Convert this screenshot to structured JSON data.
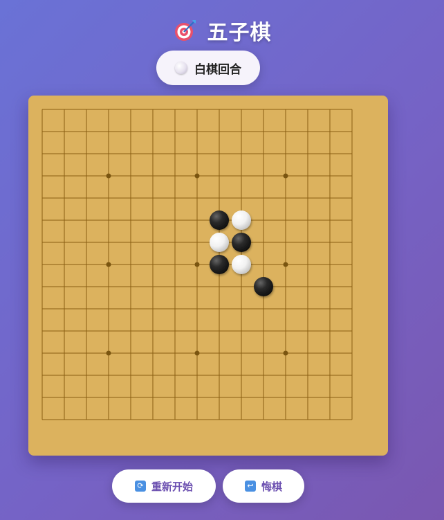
{
  "title": {
    "icon": "dart-target-icon",
    "text": "五子棋"
  },
  "turn": {
    "stone": "white",
    "text": "白棋回合"
  },
  "board": {
    "size": 15,
    "star_points": [
      [
        3,
        3
      ],
      [
        3,
        7
      ],
      [
        3,
        11
      ],
      [
        7,
        3
      ],
      [
        7,
        7
      ],
      [
        7,
        11
      ],
      [
        11,
        3
      ],
      [
        11,
        7
      ],
      [
        11,
        11
      ]
    ],
    "stones": [
      {
        "row": 5,
        "col": 8,
        "color": "black"
      },
      {
        "row": 5,
        "col": 9,
        "color": "white"
      },
      {
        "row": 6,
        "col": 8,
        "color": "white"
      },
      {
        "row": 6,
        "col": 9,
        "color": "black"
      },
      {
        "row": 7,
        "col": 8,
        "color": "black"
      },
      {
        "row": 7,
        "col": 9,
        "color": "white"
      },
      {
        "row": 8,
        "col": 10,
        "color": "black"
      }
    ]
  },
  "buttons": {
    "restart": {
      "icon": "refresh-icon",
      "label": "重新开始"
    },
    "undo": {
      "icon": "undo-arrow-icon",
      "label": "悔棋"
    }
  },
  "colors": {
    "board": "#dcb25e",
    "grid_line": "#8a5e12",
    "star_point": "#7a5510",
    "button_text": "#6b4fb0",
    "button_icon": "#4a90e2"
  }
}
